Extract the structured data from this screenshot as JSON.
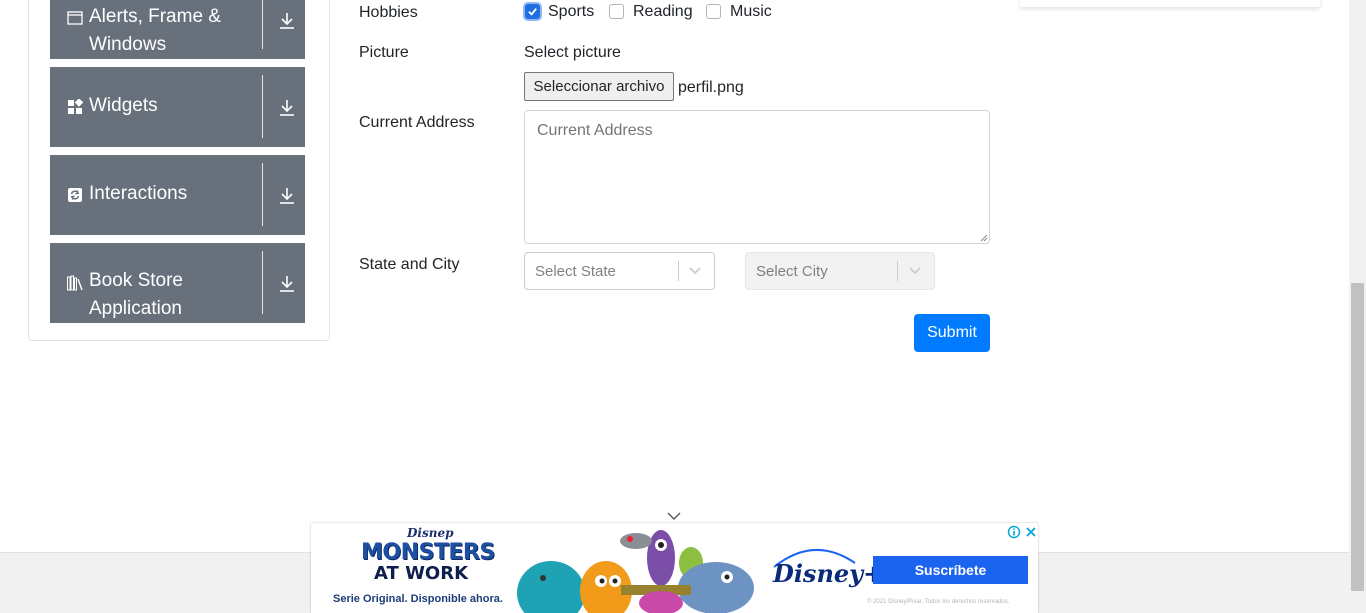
{
  "sidebar": {
    "groups": [
      {
        "label": "Alerts, Frame & Windows",
        "label_line1": "Alerts, Frame &",
        "label_line2": "Windows",
        "icon": "window-icon"
      },
      {
        "label": "Widgets",
        "icon": "widgets-icon"
      },
      {
        "label": "Interactions",
        "icon": "interactions-icon"
      },
      {
        "label": "Book Store Application",
        "label_line1": "Book Store",
        "label_line2": "Application",
        "icon": "books-icon"
      }
    ]
  },
  "form": {
    "hobbies_label": "Hobbies",
    "hobbies": [
      {
        "label": "Sports",
        "checked": true
      },
      {
        "label": "Reading",
        "checked": false
      },
      {
        "label": "Music",
        "checked": false
      }
    ],
    "picture_label": "Picture",
    "select_picture": "Select picture",
    "file_button": "Seleccionar archivo",
    "file_name": "perfil.png",
    "address_label": "Current Address",
    "address_placeholder": "Current Address",
    "state_city_label": "State and City",
    "state_placeholder": "Select State",
    "city_placeholder": "Select City",
    "submit_label": "Submit"
  },
  "ad": {
    "brand_small": "Disnep",
    "brand_title": "MONSTERS",
    "brand_subtitle": "AT WORK",
    "tagline": "Serie Original. Disponible ahora.",
    "disney_plus": "Disney+",
    "cta": "Suscríbete",
    "legal": "© 2021 Disney/Pixar. Todos los derechos reservados."
  },
  "colors": {
    "sidebar_group": "#68707c",
    "primary": "#007bff",
    "ad_cta": "#1a64f0"
  }
}
